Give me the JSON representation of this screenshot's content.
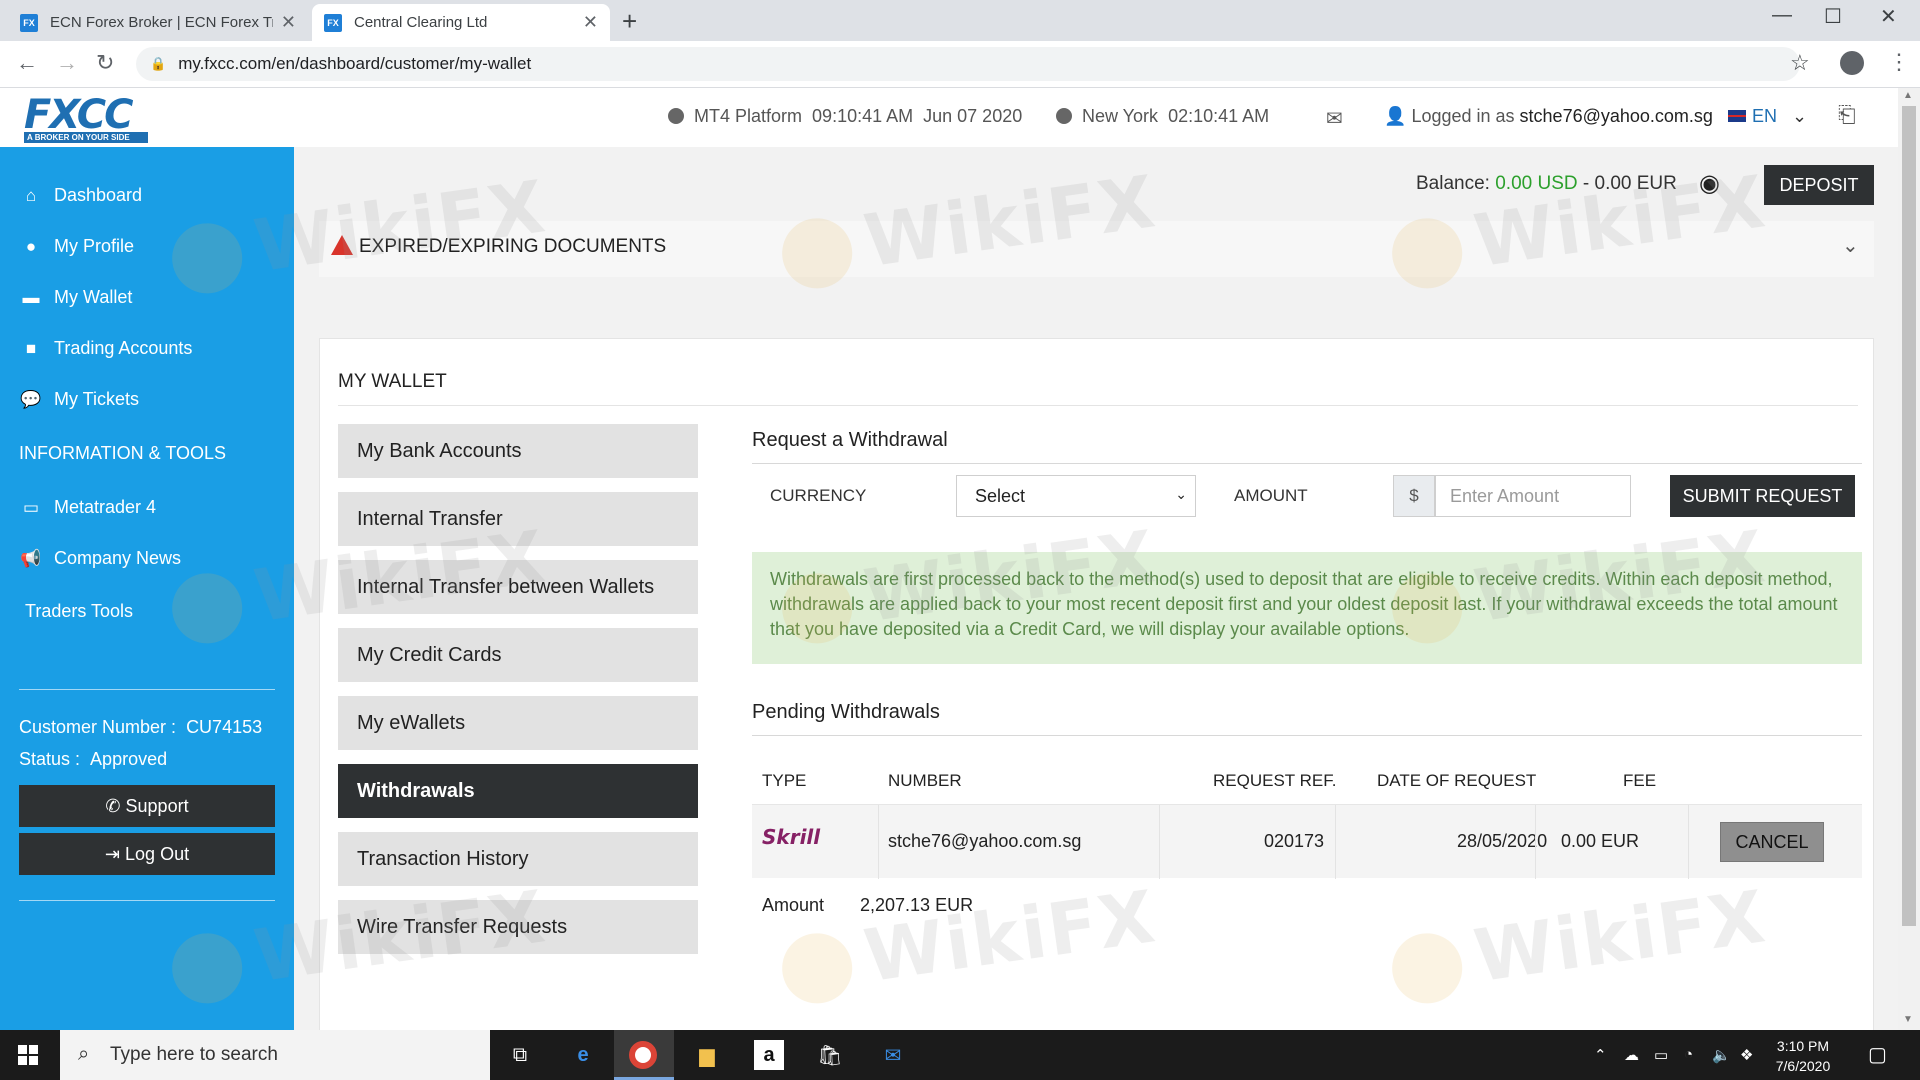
{
  "browser": {
    "tabs": [
      {
        "label": "ECN Forex Broker | ECN Forex Tra",
        "favicon": "FX"
      },
      {
        "label": "Central Clearing Ltd",
        "favicon": "FX"
      }
    ],
    "url": "my.fxcc.com/en/dashboard/customer/my-wallet"
  },
  "header": {
    "logo_text": "FXCC",
    "logo_tagline": "A BROKER ON YOUR SIDE",
    "platform_label": "MT4 Platform",
    "platform_time": "09:10:41 AM",
    "platform_date": "Jun 07 2020",
    "city": "New York",
    "city_time": "02:10:41 AM",
    "logged_in_prefix": "Logged in as",
    "user_email": "stche76@yahoo.com.sg",
    "language": "EN"
  },
  "sidebar": {
    "items": [
      {
        "label": "Dashboard",
        "icon": "home-icon"
      },
      {
        "label": "My Profile",
        "icon": "user-icon"
      },
      {
        "label": "My Wallet",
        "icon": "folder-icon"
      },
      {
        "label": "Trading Accounts",
        "icon": "briefcase-icon"
      },
      {
        "label": "My Tickets",
        "icon": "chat-icon"
      }
    ],
    "section_heading": "INFORMATION & TOOLS",
    "tools": [
      {
        "label": "Metatrader 4",
        "icon": "monitor-icon"
      },
      {
        "label": "Company News",
        "icon": "megaphone-icon"
      },
      {
        "label": "Traders Tools",
        "icon": ""
      }
    ],
    "customer_number_label": "Customer Number :",
    "customer_number": "CU74153",
    "status_label": "Status :",
    "status": "Approved",
    "support_label": "Support",
    "logout_label": "Log Out"
  },
  "balance": {
    "label": "Balance:",
    "usd": "0.00 USD",
    "separator": "-",
    "eur": "0.00 EUR",
    "deposit_label": "DEPOSIT"
  },
  "expired_docs": {
    "label": "EXPIRED/EXPIRING DOCUMENTS"
  },
  "wallet": {
    "title": "MY WALLET",
    "menu": [
      {
        "label": "My Bank Accounts",
        "active": false
      },
      {
        "label": "Internal Transfer",
        "active": false
      },
      {
        "label": "Internal Transfer between Wallets",
        "active": false
      },
      {
        "label": "My Credit Cards",
        "active": false
      },
      {
        "label": "My eWallets",
        "active": false
      },
      {
        "label": "Withdrawals",
        "active": true
      },
      {
        "label": "Transaction History",
        "active": false
      },
      {
        "label": "Wire Transfer Requests",
        "active": false
      }
    ]
  },
  "withdrawal": {
    "title": "Request a Withdrawal",
    "currency_label": "CURRENCY",
    "currency_value": "Select",
    "amount_label": "AMOUNT",
    "amount_prefix": "$",
    "amount_placeholder": "Enter Amount",
    "submit_label": "SUBMIT REQUEST",
    "notice": "Withdrawals are first processed back to the method(s) used to deposit that are eligible to receive credits. Within each deposit method, withdrawals are applied back to your most recent deposit first and your oldest deposit last. If your withdrawal exceeds the total amount that you have deposited via a Credit Card, we will display your available options."
  },
  "pending": {
    "title": "Pending Withdrawals",
    "columns": [
      "TYPE",
      "NUMBER",
      "REQUEST REF.",
      "DATE OF REQUEST",
      "FEE"
    ],
    "rows": [
      {
        "type": "Skrill",
        "number": "stche76@yahoo.com.sg",
        "ref": "020173",
        "date": "28/05/2020",
        "fee": "0.00 EUR",
        "action": "CANCEL"
      }
    ],
    "amount_label": "Amount",
    "amount_value": "2,207.13 EUR"
  },
  "watermark": "WikiFX",
  "taskbar": {
    "search_placeholder": "Type here to search",
    "time": "3:10 PM",
    "date": "7/6/2020"
  },
  "colors": {
    "sidebar_blue": "#1a9ee5",
    "dark_button": "#2e3133",
    "balance_green": "#2ca02c",
    "notice_bg": "#dff0d8",
    "skrill_purple": "#862165"
  }
}
